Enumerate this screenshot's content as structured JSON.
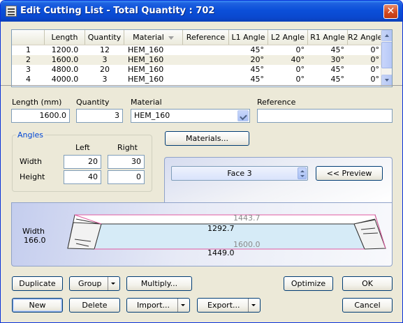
{
  "window": {
    "title": "Edit Cutting List - Total Quantity : 702",
    "close_glyph": "✕"
  },
  "list": {
    "columns": [
      "",
      "Length",
      "Quantity",
      "Material",
      "Reference",
      "L1 Angle",
      "L2 Angle",
      "R1 Angle",
      "R2 Angle"
    ],
    "rows": [
      [
        "1",
        "1200.0",
        "12",
        "HEM_160",
        "",
        "45°",
        "0°",
        "45°",
        "0°"
      ],
      [
        "2",
        "1600.0",
        "3",
        "HEM_160",
        "",
        "20°",
        "40°",
        "30°",
        "0°"
      ],
      [
        "3",
        "4800.0",
        "20",
        "HEM_160",
        "",
        "45°",
        "0°",
        "45°",
        "0°"
      ],
      [
        "4",
        "4000.0",
        "3",
        "HEM_160",
        "",
        "45°",
        "0°",
        "45°",
        "0°"
      ]
    ]
  },
  "form": {
    "length_label": "Length (mm)",
    "length_value": "1600.0",
    "quantity_label": "Quantity",
    "quantity_value": "3",
    "material_label": "Material",
    "material_value": "HEM_160",
    "reference_label": "Reference",
    "reference_value": ""
  },
  "angles": {
    "title": "Angles",
    "left_label": "Left",
    "right_label": "Right",
    "width_label": "Width",
    "height_label": "Height",
    "width_left": "20",
    "width_right": "30",
    "height_left": "40",
    "height_right": "0"
  },
  "preview": {
    "materials_button": "Materials...",
    "face_value": "Face 3",
    "preview_button": "<<   Preview",
    "width_label": "Width",
    "width_value": "166.0",
    "dim_top_outer": "1443.7",
    "dim_top_inner": "1292.7",
    "dim_bottom_inner": "1600.0",
    "dim_bottom_outer": "1449.0"
  },
  "buttons": {
    "duplicate": "Duplicate",
    "group": "Group",
    "multiply": "Multiply...",
    "optimize": "Optimize",
    "ok": "OK",
    "new": "New",
    "delete": "Delete",
    "import": "Import...",
    "export": "Export...",
    "cancel": "Cancel"
  }
}
